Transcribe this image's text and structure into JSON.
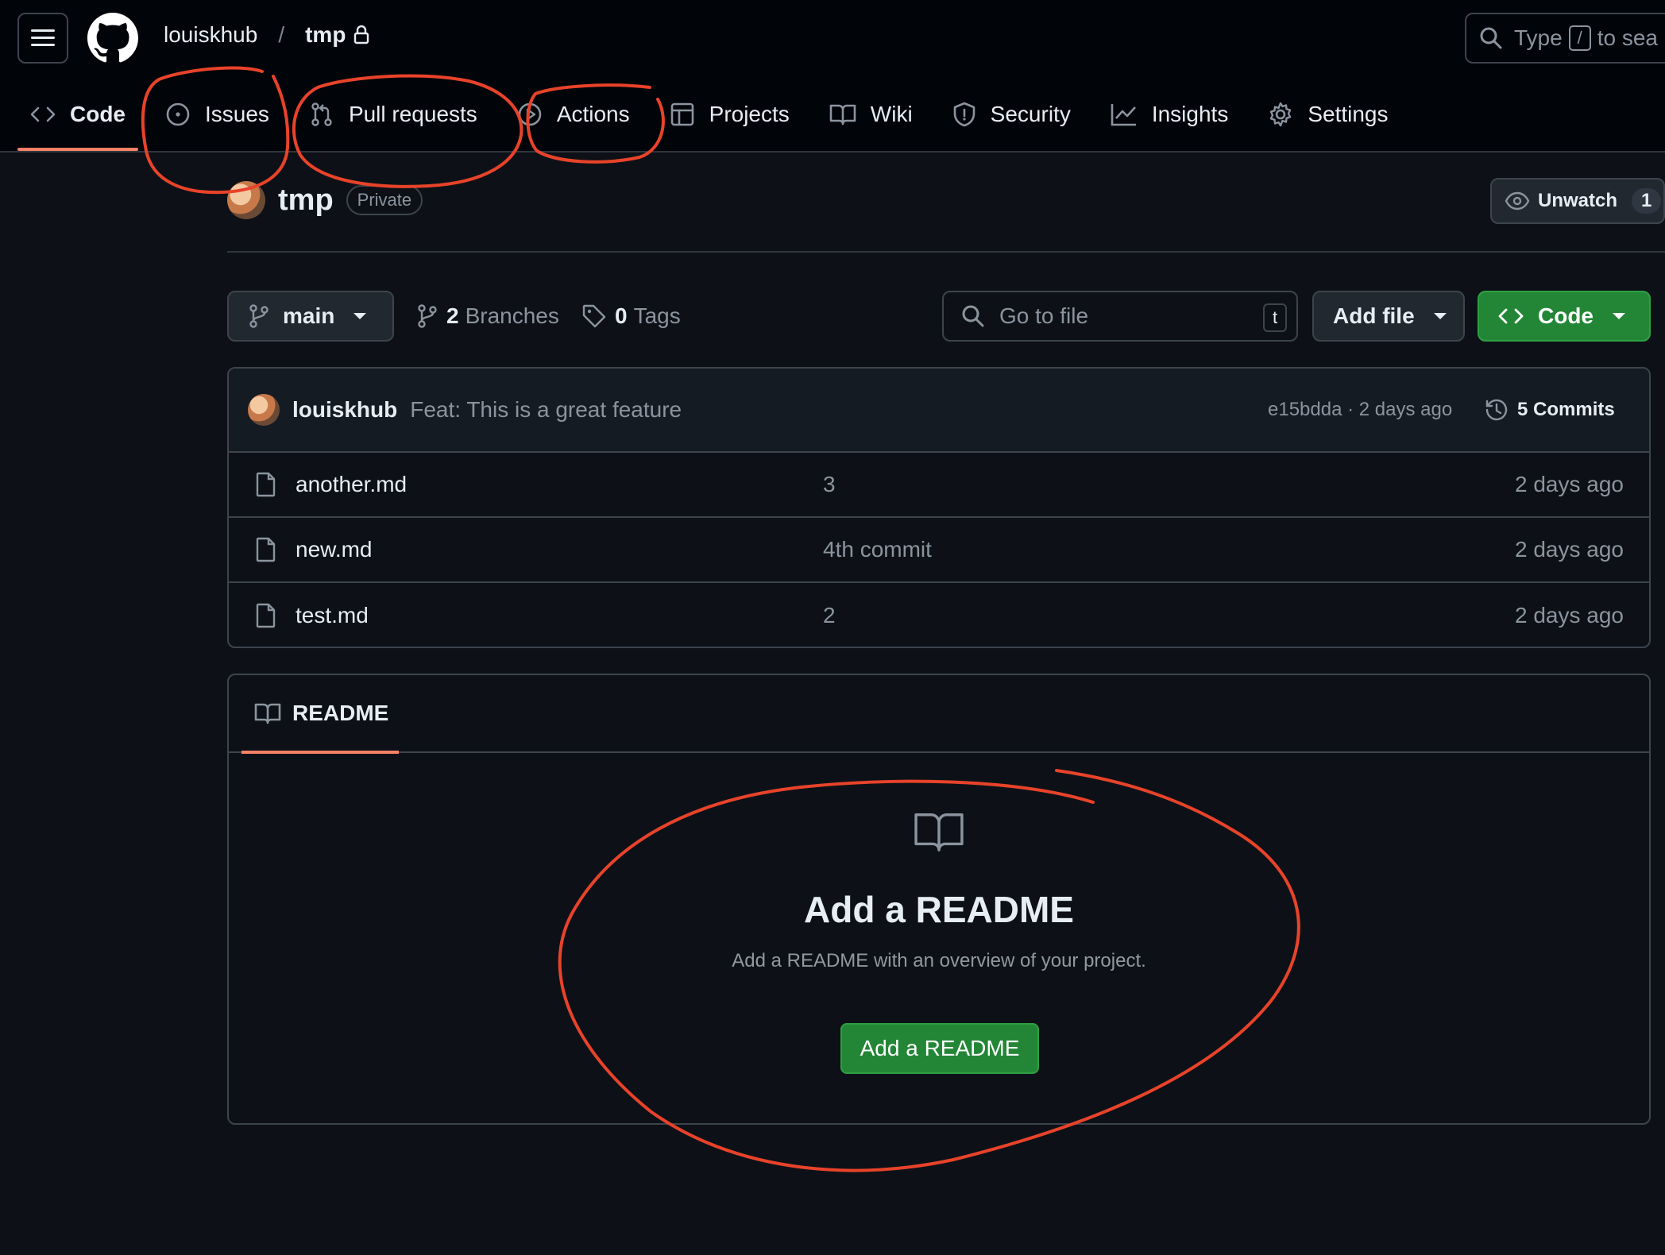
{
  "header": {
    "owner": "louiskhub",
    "separator": "/",
    "repo": "tmp",
    "search_text_1": "Type",
    "search_key": "/",
    "search_text_2": "to sea"
  },
  "tabs": [
    {
      "label": "Code",
      "icon": "code-icon",
      "active": true
    },
    {
      "label": "Issues",
      "icon": "issue-icon"
    },
    {
      "label": "Pull requests",
      "icon": "pull-request-icon"
    },
    {
      "label": "Actions",
      "icon": "play-icon"
    },
    {
      "label": "Projects",
      "icon": "table-icon"
    },
    {
      "label": "Wiki",
      "icon": "book-icon"
    },
    {
      "label": "Security",
      "icon": "shield-icon"
    },
    {
      "label": "Insights",
      "icon": "graph-icon"
    },
    {
      "label": "Settings",
      "icon": "gear-icon"
    }
  ],
  "repo_header": {
    "name": "tmp",
    "visibility": "Private",
    "unwatch_label": "Unwatch",
    "watch_count": "1"
  },
  "toolbar": {
    "branch": "main",
    "branches_count": "2",
    "branches_label": "Branches",
    "tags_count": "0",
    "tags_label": "Tags",
    "go_to_file": "Go to file",
    "go_to_file_key": "t",
    "add_file": "Add file",
    "code": "Code"
  },
  "latest_commit": {
    "author": "louiskhub",
    "message": "Feat: This is a great feature",
    "hash_time": "e15bdda · 2 days ago",
    "commits_label": "5 Commits"
  },
  "files": [
    {
      "name": "another.md",
      "message": "3",
      "date": "2 days ago"
    },
    {
      "name": "new.md",
      "message": "4th commit",
      "date": "2 days ago"
    },
    {
      "name": "test.md",
      "message": "2",
      "date": "2 days ago"
    }
  ],
  "readme": {
    "tab_label": "README",
    "title": "Add a README",
    "subtitle": "Add a README with an overview of your project.",
    "button": "Add a README"
  },
  "colors": {
    "accent_green": "#238636",
    "tab_underline": "#f78166",
    "annotation_red": "#e8432a"
  }
}
